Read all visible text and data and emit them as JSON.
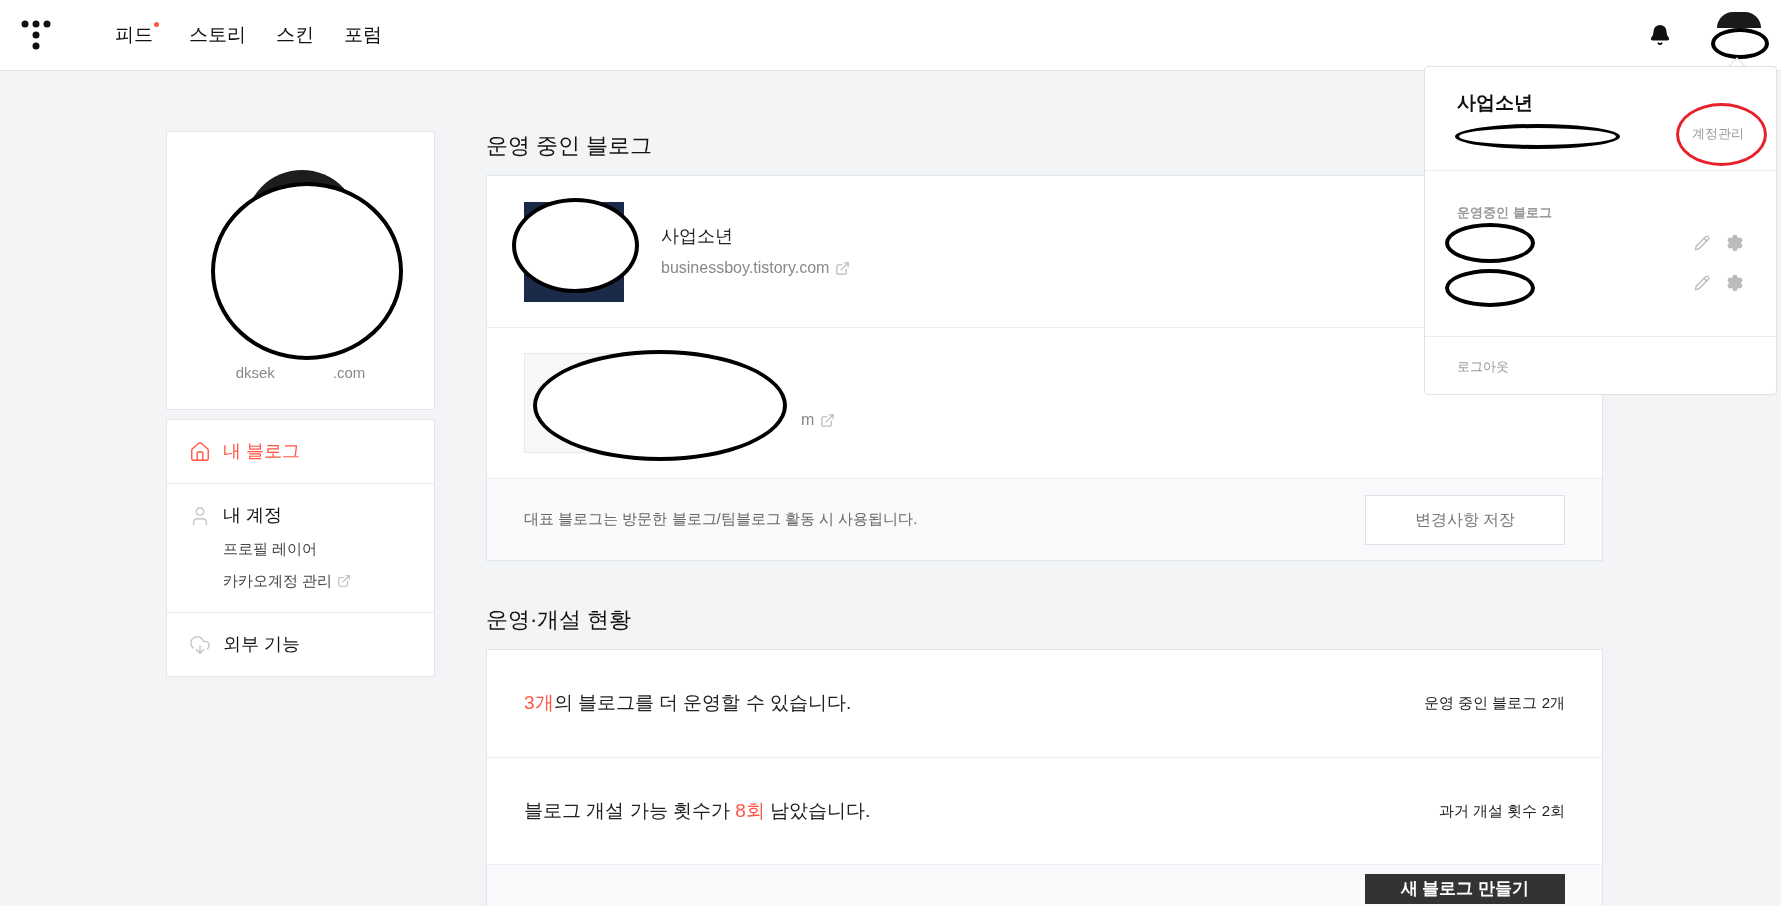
{
  "header": {
    "nav": [
      {
        "label": "피드",
        "badge": true
      },
      {
        "label": "스토리",
        "badge": false
      },
      {
        "label": "스킨",
        "badge": false
      },
      {
        "label": "포럼",
        "badge": false
      }
    ]
  },
  "profile": {
    "email_start": "dksek",
    "email_end": ".com"
  },
  "menu": [
    {
      "label": "내 블로그",
      "selected": true
    },
    {
      "label": "내 계정",
      "selected": false,
      "children": [
        {
          "label": "프로필 레이어",
          "external": false
        },
        {
          "label": "카카오계정 관리",
          "external": true
        }
      ]
    },
    {
      "label": "외부 기능",
      "selected": false
    }
  ],
  "blogs": {
    "title": "운영 중인 블로그",
    "items": [
      {
        "kind": "plain",
        "name": "사업소년",
        "url": "businessboy.tistory.com"
      },
      {
        "kind": "redacted",
        "url": "m"
      }
    ],
    "note": "대표 블로그는 방문한 블로그/팀블로그 활동 시 사용됩니다.",
    "save_button": "변경사항 저장"
  },
  "status": {
    "title": "운영·개설 현황",
    "rows": [
      {
        "before": "",
        "highlight": "3개",
        "after": "의 블로그를 더 운영할 수 있습니다.",
        "side": "운영 중인 블로그 2개"
      },
      {
        "before": "블로그 개설 가능 횟수가 ",
        "highlight": "8회",
        "after": " 남았습니다.",
        "side": "과거 개설 횟수 2회"
      }
    ],
    "new_blog_button": "새 블로그 만들기"
  },
  "dropdown": {
    "name": "사업소년",
    "account_link": "계정관리",
    "section": "운영중인 블로그",
    "blogs": [
      {
        "kind": "redacted"
      },
      {
        "kind": "redacted"
      }
    ],
    "logout": "로그아웃"
  }
}
